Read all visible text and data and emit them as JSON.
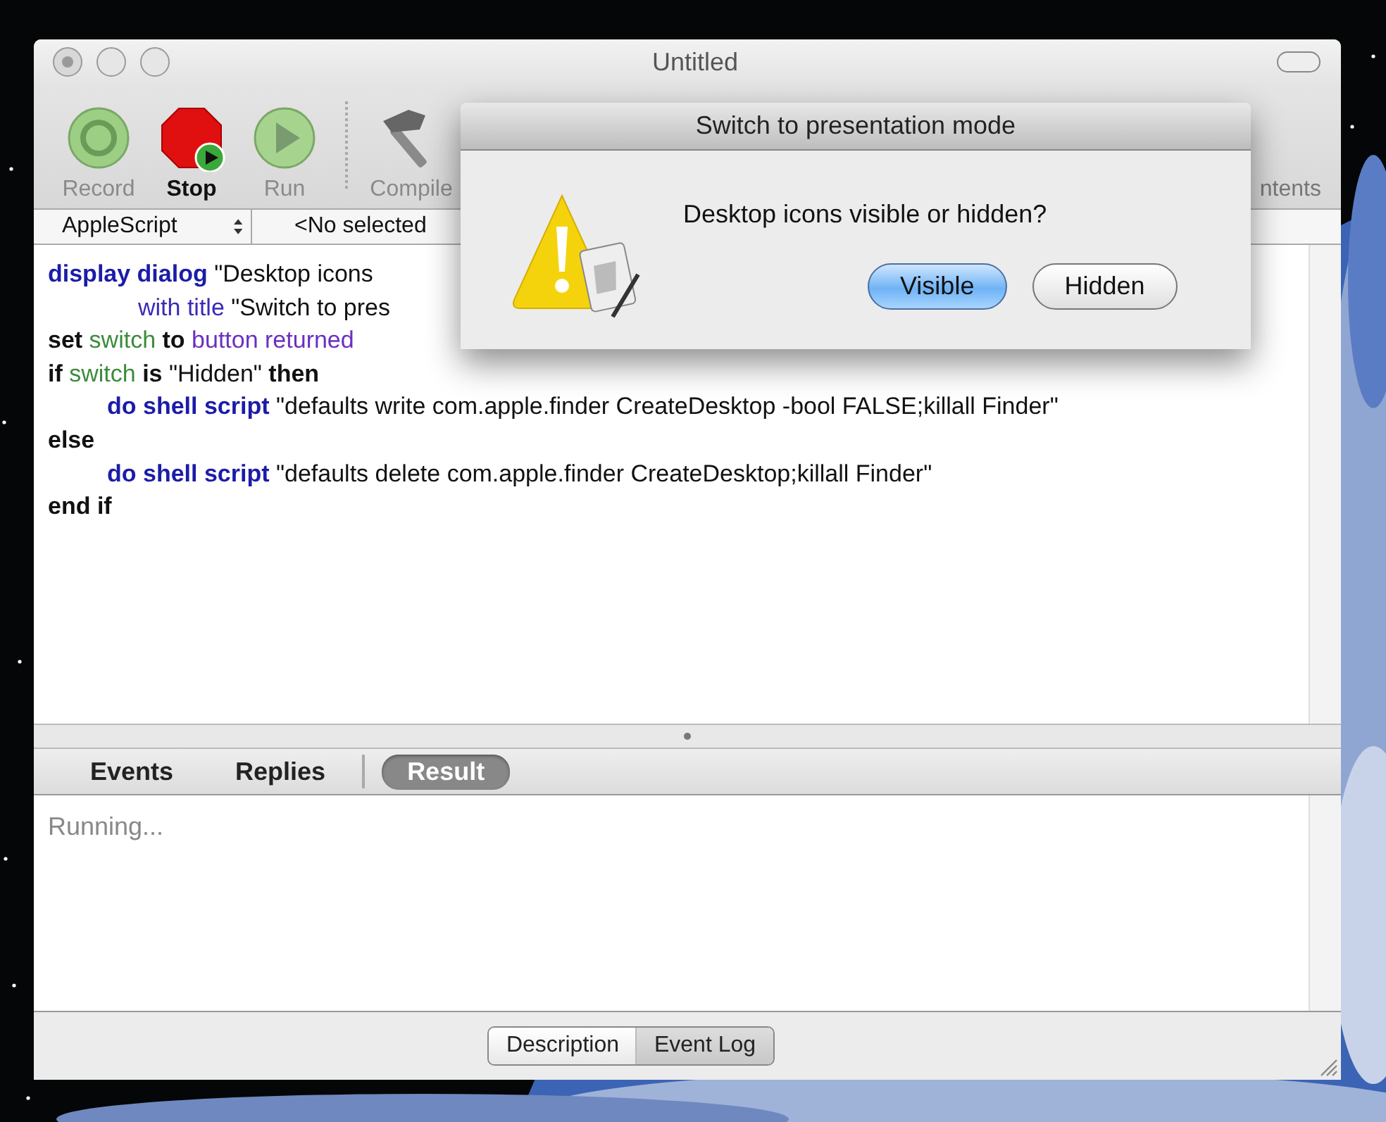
{
  "window": {
    "title": "Untitled",
    "toolbar": [
      {
        "label": "Record",
        "kind": "record",
        "disabled": true
      },
      {
        "label": "Stop",
        "kind": "stop",
        "disabled": false
      },
      {
        "label": "Run",
        "kind": "run",
        "disabled": true
      },
      {
        "label": "Compile",
        "kind": "compile",
        "disabled": true
      }
    ],
    "toolbar_cut_label": "ntents",
    "navigation": {
      "language": "AppleScript",
      "handler": "<No selected"
    },
    "editor": {
      "lines": [
        {
          "kind": "statement",
          "tokens": [
            {
              "kind": "command",
              "text": "display dialog"
            },
            {
              "kind": "text",
              "text": " \"Desktop icons"
            }
          ]
        },
        {
          "kind": "continuation",
          "tokens": [
            {
              "kind": "parameter",
              "text": "with title"
            },
            {
              "kind": "text",
              "text": " \"Switch to pres"
            }
          ]
        },
        {
          "kind": "statement",
          "tokens": [
            {
              "kind": "language",
              "text": "set"
            },
            {
              "kind": "variable",
              "text": " switch "
            },
            {
              "kind": "language",
              "text": "to"
            },
            {
              "kind": "property",
              "text": " button returned"
            }
          ]
        },
        {
          "kind": "statement",
          "tokens": [
            {
              "kind": "language",
              "text": "if"
            },
            {
              "kind": "variable",
              "text": " switch "
            },
            {
              "kind": "language",
              "text": "is"
            },
            {
              "kind": "text",
              "text": " \"Hidden\" "
            },
            {
              "kind": "language",
              "text": "then"
            }
          ]
        },
        {
          "kind": "body",
          "tokens": [
            {
              "kind": "command",
              "text": "do shell script"
            },
            {
              "kind": "text",
              "text": " \"defaults write com.apple.finder CreateDesktop -bool FALSE;killall Finder\""
            }
          ]
        },
        {
          "kind": "statement",
          "tokens": [
            {
              "kind": "language",
              "text": "else"
            }
          ]
        },
        {
          "kind": "body",
          "tokens": [
            {
              "kind": "command",
              "text": "do shell script"
            },
            {
              "kind": "text",
              "text": " \"defaults delete com.apple.finder CreateDesktop;killall Finder\""
            }
          ]
        },
        {
          "kind": "statement",
          "tokens": [
            {
              "kind": "language",
              "text": "end if"
            }
          ]
        }
      ]
    },
    "log_tabs": [
      {
        "label": "Events",
        "selected": false
      },
      {
        "label": "Replies",
        "selected": false
      },
      {
        "label": "Result",
        "selected": true
      }
    ],
    "result_text": "Running...",
    "bottom_tabs": [
      {
        "label": "Description",
        "selected": false
      },
      {
        "label": "Event Log",
        "selected": true
      }
    ]
  },
  "dialog": {
    "title": "Switch to presentation mode",
    "message": "Desktop icons visible or hidden?",
    "buttons": [
      {
        "label": "Visible",
        "default": true
      },
      {
        "label": "Hidden",
        "default": false
      }
    ]
  }
}
